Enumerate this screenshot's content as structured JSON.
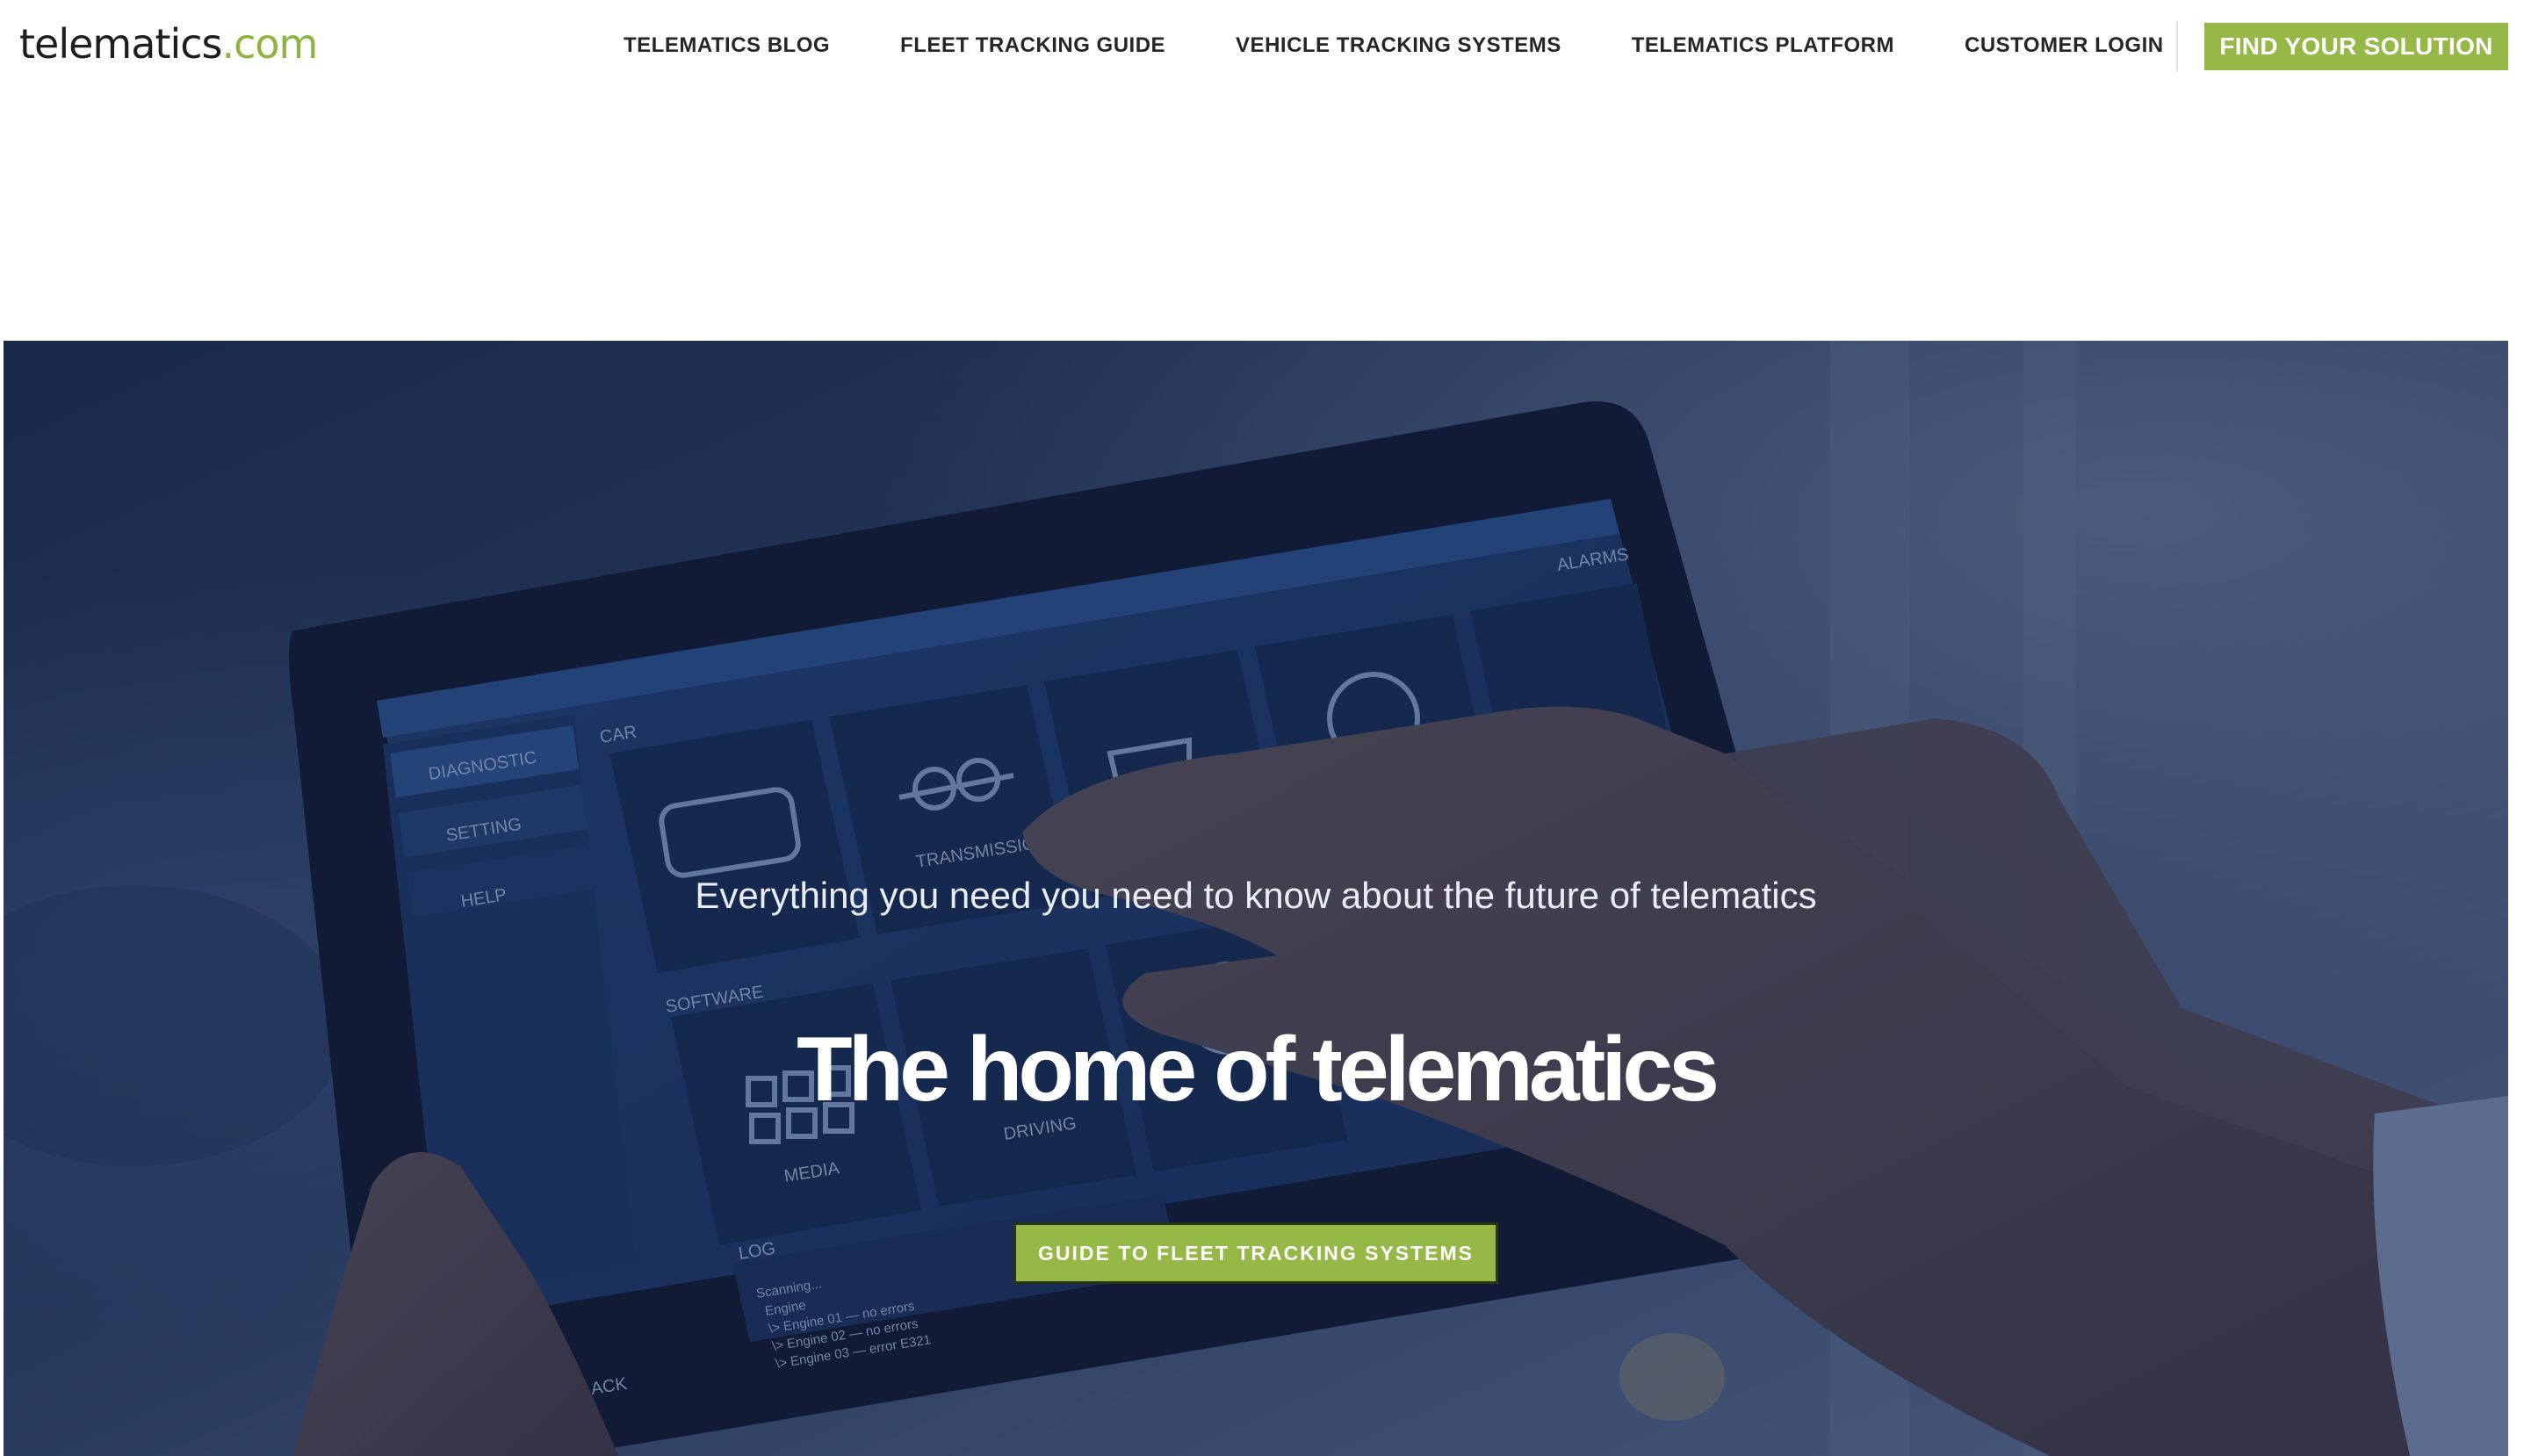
{
  "header": {
    "logo": {
      "part1": "telematics",
      "part2": ".com"
    },
    "nav": [
      {
        "label": "TELEMATICS BLOG"
      },
      {
        "label": "FLEET TRACKING GUIDE"
      },
      {
        "label": "VEHICLE TRACKING SYSTEMS"
      },
      {
        "label": "TELEMATICS PLATFORM"
      },
      {
        "label": "CUSTOMER LOGIN"
      }
    ],
    "cta": "FIND YOUR SOLUTION"
  },
  "hero": {
    "subtitle": "Everything you need you need to know about the future of telematics",
    "title": "The home of telematics",
    "cta": "GUIDE TO FLEET TRACKING SYSTEMS",
    "image": {
      "sidebar": [
        "DIAGNOSTIC",
        "SETTING",
        "HELP"
      ],
      "sections": [
        "CAR",
        "SOFTWARE",
        "LOG"
      ],
      "tiles": [
        "TRANSMISSION",
        "MEDIA",
        "DRIVING"
      ],
      "top_right": "ALARMS",
      "log_lines": [
        "Scanning...",
        "Engine",
        "\\> Engine 01 — no errors",
        "\\> Engine 02 — no errors",
        "\\> Engine 03 — error E321"
      ],
      "back": "ACK"
    }
  },
  "colors": {
    "accent": "#96b847",
    "logo_accent": "#8db43e",
    "nav_text": "#262626",
    "hero_overlay": "#16244a"
  }
}
